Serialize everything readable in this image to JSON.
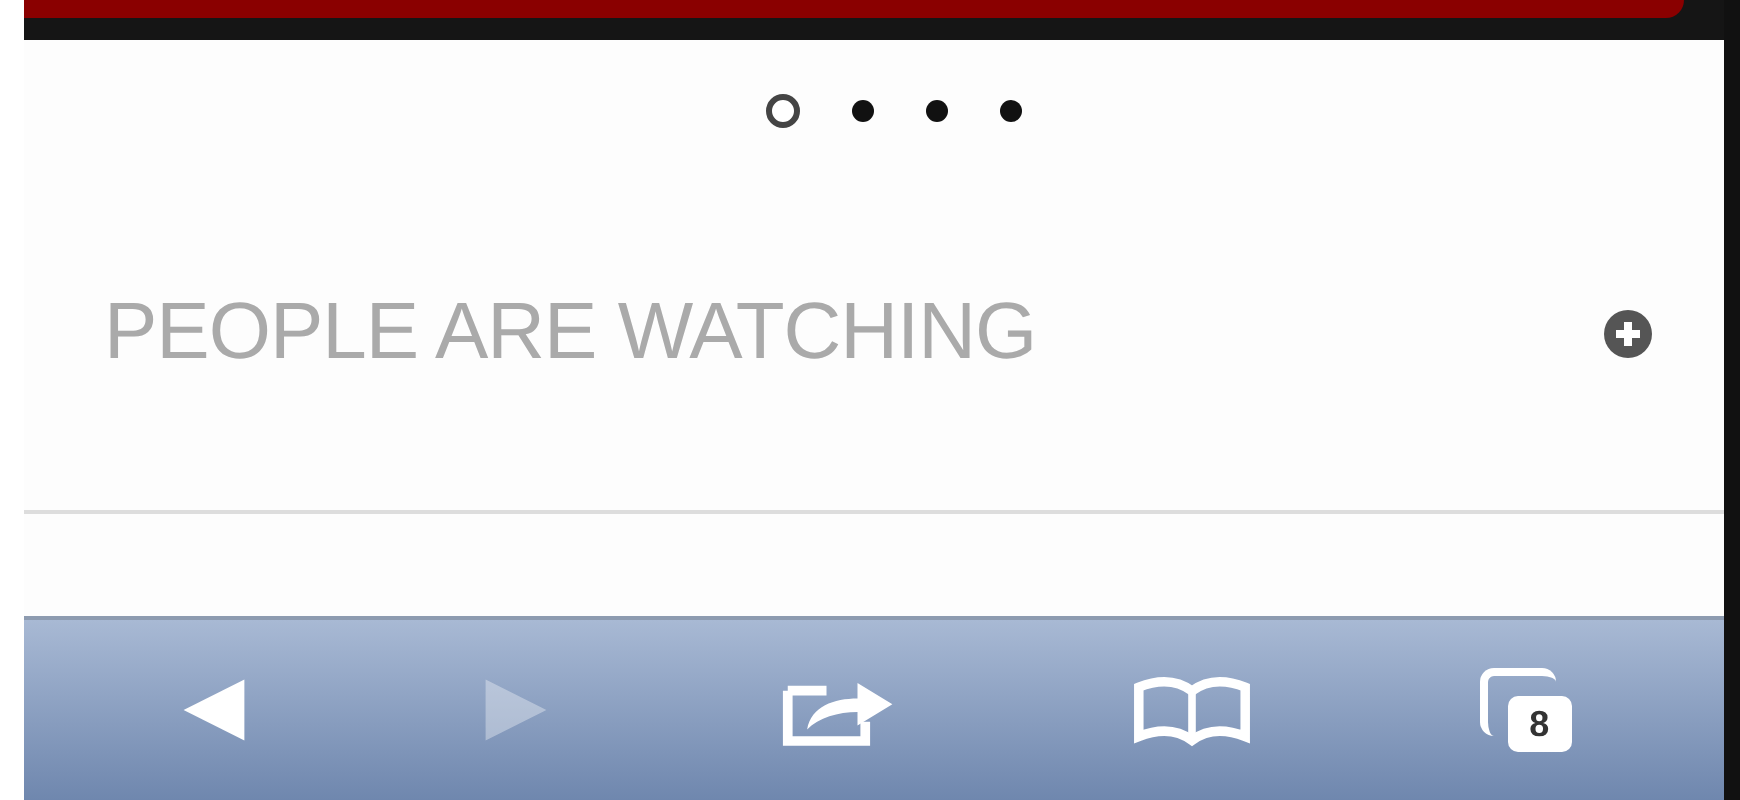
{
  "page_indicator": [
    {
      "selected": true
    },
    {
      "selected": false
    },
    {
      "selected": false
    },
    {
      "selected": false
    }
  ],
  "section": {
    "title": "PEOPLE ARE WATCHING"
  },
  "toolbar": [
    {
      "kind": "back",
      "disabled": false
    },
    {
      "kind": "forward",
      "disabled": true
    },
    {
      "kind": "share",
      "disabled": false
    },
    {
      "kind": "bookmarks",
      "disabled": false
    },
    {
      "kind": "tabs",
      "disabled": false,
      "count": "8"
    }
  ]
}
